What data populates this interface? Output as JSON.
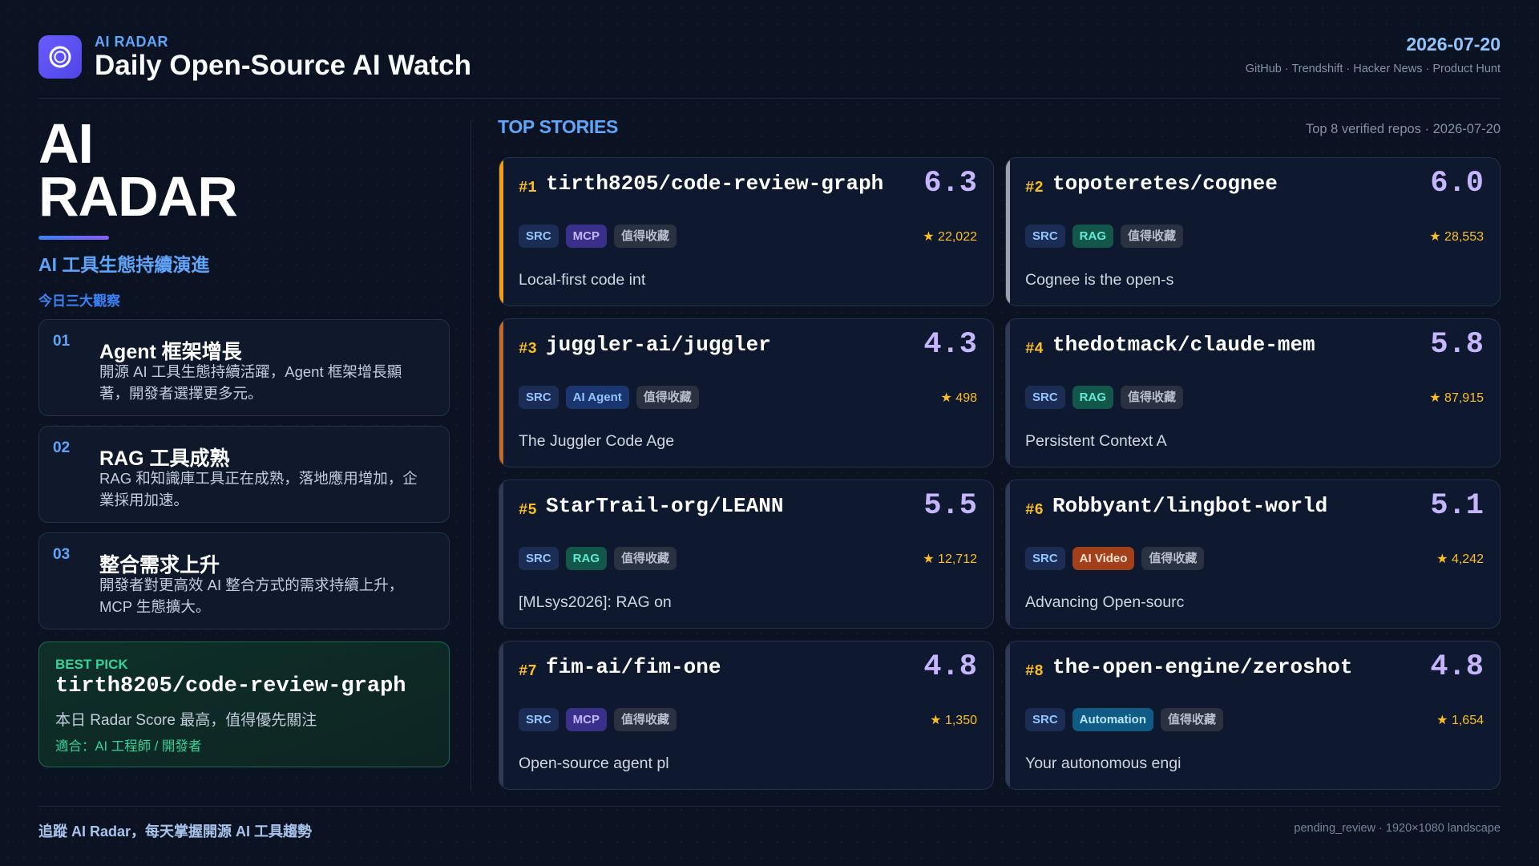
{
  "header": {
    "brand_small": "AI RADAR",
    "title": "Daily Open-Source AI Watch",
    "date": "2026-07-20",
    "sources": "GitHub · Trendshift · Hacker News · Product Hunt",
    "logo_icon": "radar-ring-icon"
  },
  "left": {
    "hero_line1": "AI",
    "hero_line2": "RADAR",
    "subtitle": "AI 工具生態持續演進",
    "insights_label": "今日三大觀察",
    "insights": [
      {
        "num": "01",
        "title": "Agent 框架增長",
        "desc": "開源 AI 工具生態持續活躍，Agent 框架增長顯著，開發者選擇更多元。"
      },
      {
        "num": "02",
        "title": "RAG 工具成熟",
        "desc": "RAG 和知識庫工具正在成熟，落地應用增加，企業採用加速。"
      },
      {
        "num": "03",
        "title": "整合需求上升",
        "desc": "開發者對更高效 AI 整合方式的需求持續上升，MCP 生態擴大。"
      }
    ],
    "best_pick": {
      "label": "BEST PICK",
      "repo": "tirth8205/code-review-graph",
      "desc": "本日 Radar Score 最高，值得優先關注",
      "fit": "適合：AI 工程師 / 開發者"
    }
  },
  "stories": {
    "title": "TOP STORIES",
    "meta": "Top 8 verified repos · 2026-07-20",
    "cards": [
      {
        "rank": "#1",
        "repo": "tirth8205/code-review-graph",
        "score": "6.3",
        "tags": [
          {
            "label": "SRC",
            "kind": "src"
          },
          {
            "label": "MCP",
            "kind": "mcp"
          },
          {
            "label": "值得收藏",
            "kind": "fav"
          }
        ],
        "stars": "★ 22,022",
        "desc": "Local-first code int",
        "accent": "#f59e0b"
      },
      {
        "rank": "#2",
        "repo": "topoteretes/cognee",
        "score": "6.0",
        "tags": [
          {
            "label": "SRC",
            "kind": "src"
          },
          {
            "label": "RAG",
            "kind": "rag"
          },
          {
            "label": "值得收藏",
            "kind": "fav"
          }
        ],
        "stars": "★ 28,553",
        "desc": "Cognee is the open-s",
        "accent": "#9ca3af"
      },
      {
        "rank": "#3",
        "repo": "juggler-ai/juggler",
        "score": "4.3",
        "tags": [
          {
            "label": "SRC",
            "kind": "src"
          },
          {
            "label": "AI Agent",
            "kind": "agent"
          },
          {
            "label": "值得收藏",
            "kind": "fav"
          }
        ],
        "stars": "★ 498",
        "desc": "The Juggler Code Age",
        "accent": "#c2692c"
      },
      {
        "rank": "#4",
        "repo": "thedotmack/claude-mem",
        "score": "5.8",
        "tags": [
          {
            "label": "SRC",
            "kind": "src"
          },
          {
            "label": "RAG",
            "kind": "rag"
          },
          {
            "label": "值得收藏",
            "kind": "fav"
          }
        ],
        "stars": "★ 87,915",
        "desc": "Persistent Context A",
        "accent": "#2e3b52"
      },
      {
        "rank": "#5",
        "repo": "StarTrail-org/LEANN",
        "score": "5.5",
        "tags": [
          {
            "label": "SRC",
            "kind": "src"
          },
          {
            "label": "RAG",
            "kind": "rag"
          },
          {
            "label": "值得收藏",
            "kind": "fav"
          }
        ],
        "stars": "★ 12,712",
        "desc": "[MLsys2026]: RAG on",
        "accent": "#2e3b52"
      },
      {
        "rank": "#6",
        "repo": "Robbyant/lingbot-world",
        "score": "5.1",
        "tags": [
          {
            "label": "SRC",
            "kind": "src"
          },
          {
            "label": "AI Video",
            "kind": "video"
          },
          {
            "label": "值得收藏",
            "kind": "fav"
          }
        ],
        "stars": "★ 4,242",
        "desc": "Advancing Open-sourc",
        "accent": "#2e3b52"
      },
      {
        "rank": "#7",
        "repo": "fim-ai/fim-one",
        "score": "4.8",
        "tags": [
          {
            "label": "SRC",
            "kind": "src"
          },
          {
            "label": "MCP",
            "kind": "mcp"
          },
          {
            "label": "值得收藏",
            "kind": "fav"
          }
        ],
        "stars": "★ 1,350",
        "desc": "Open-source agent pl",
        "accent": "#2e3b52"
      },
      {
        "rank": "#8",
        "repo": "the-open-engine/zeroshot",
        "score": "4.8",
        "tags": [
          {
            "label": "SRC",
            "kind": "src"
          },
          {
            "label": "Automation",
            "kind": "auto"
          },
          {
            "label": "值得收藏",
            "kind": "fav"
          }
        ],
        "stars": "★ 1,654",
        "desc": "Your autonomous engi",
        "accent": "#2e3b52"
      }
    ]
  },
  "footer": {
    "left": "追蹤 AI Radar，每天掌握開源 AI 工具趨勢",
    "right": "pending_review · 1920×1080 landscape"
  },
  "colors": {
    "background": "#0b1322",
    "accent_blue": "#60a5fa",
    "score_purple": "#c4b5fd",
    "rank_gold": "#fbbf24",
    "best_pick_green": "#34d399"
  }
}
